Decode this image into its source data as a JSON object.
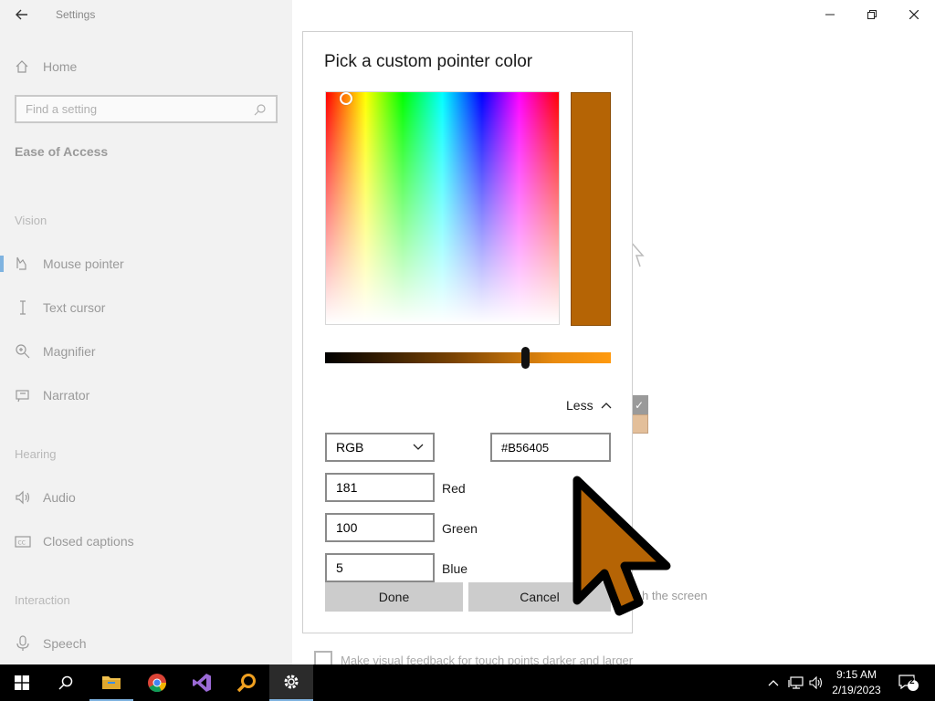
{
  "app": {
    "title": "Settings"
  },
  "nav": {
    "home_label": "Home",
    "search_placeholder": "Find a setting",
    "section_title": "Ease of Access",
    "groups": {
      "vision": "Vision",
      "hearing": "Hearing",
      "interaction": "Interaction"
    },
    "items": [
      {
        "label": "Mouse pointer",
        "icon": "mouse-pointer-icon",
        "selected": true
      },
      {
        "label": "Text cursor",
        "icon": "text-cursor-icon"
      },
      {
        "label": "Magnifier",
        "icon": "magnifier-icon"
      },
      {
        "label": "Narrator",
        "icon": "narrator-icon"
      },
      {
        "label": "Audio",
        "icon": "audio-icon"
      },
      {
        "label": "Closed captions",
        "icon": "closed-captions-icon"
      },
      {
        "label": "Speech",
        "icon": "microphone-icon"
      }
    ]
  },
  "background": {
    "touch_text_fragment": "h the screen",
    "checkbox_label": "Make visual feedback for touch points darker and larger"
  },
  "dialog": {
    "title": "Pick a custom pointer color",
    "selected_color": "#B56405",
    "less_label": "Less",
    "mode": "RGB",
    "hex_value": "#B56405",
    "red_value": "181",
    "red_label": "Red",
    "green_value": "100",
    "green_label": "Green",
    "blue_value": "5",
    "blue_label": "Blue",
    "done_label": "Done",
    "cancel_label": "Cancel"
  },
  "taskbar": {
    "apps": [
      "start-icon",
      "search-icon",
      "file-explorer-icon",
      "chrome-icon",
      "visual-studio-icon",
      "magnifier-app-icon",
      "settings-icon"
    ],
    "time": "9:15 AM",
    "date": "2/19/2023",
    "notification_count": "2"
  }
}
